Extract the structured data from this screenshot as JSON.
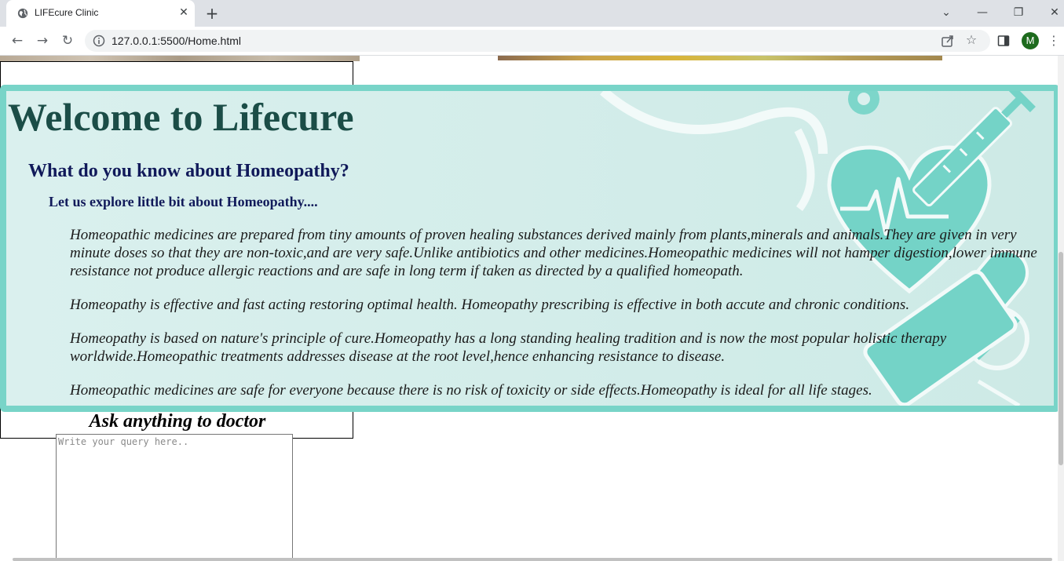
{
  "browser": {
    "tab_title": "LIFEcure Clinic",
    "tab_close": "✕",
    "new_tab": "+",
    "url": "127.0.0.1:5500/Home.html",
    "avatar_initial": "M",
    "icons": [
      "globe-icon",
      "back-icon",
      "forward-icon",
      "reload-icon",
      "info-icon",
      "share-icon",
      "star-icon",
      "side-panel-icon",
      "kebab-menu-icon",
      "chevron-down-icon",
      "minimize-icon",
      "restore-icon",
      "close-icon"
    ]
  },
  "page": {
    "welcome": {
      "title": "Welcome to Lifecure",
      "subtitle": "What do you know about Homeopathy?",
      "lead": "Let us explore little bit about Homeopathy....",
      "paragraphs": [
        "Homeopathic medicines are prepared from tiny amounts of proven healing substances derived mainly from plants,minerals and animals.They are given in very minute doses so that they are non-toxic,and are very safe.Unlike antibiotics and other medicines.Homeopathic medicines will not hamper digestion,lower immune resistance not produce allergic reactions and are safe in long term if taken as directed by a qualified homeopath.",
        "Homeopathy is effective and fast acting restoring optimal health. Homeopathy prescribing is effective in both accute and chronic conditions.",
        "Homeopathy is based on nature's principle of cure.Homeopathy has a long standing healing tradition and is now the most popular holistic therapy worldwide.Homeopathic treatments addresses disease at the root level,hence enhancing resistance to disease.",
        "Homeopathic medicines are safe for everyone because there is no risk of toxicity or side effects.Homeopathy is ideal for all life stages."
      ]
    },
    "ask": {
      "title": "Ask anything to doctor",
      "placeholder": "Write your query here.."
    },
    "colors": {
      "banner_border": "#78d4c8",
      "banner_bg": "#daf0ee",
      "title_color": "#1b4d47",
      "heading_color": "#111a5a"
    }
  }
}
